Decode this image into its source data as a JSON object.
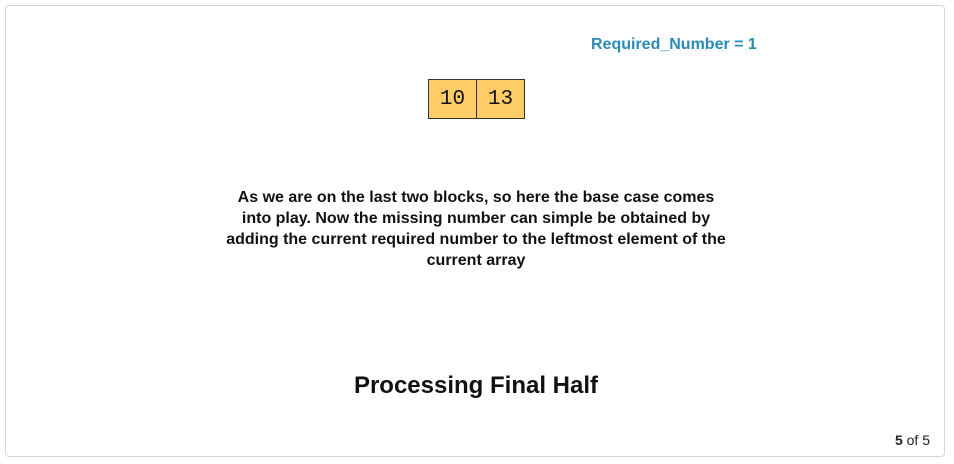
{
  "required_number_label": "Required_Number = 1",
  "array": {
    "cells": [
      "10",
      "13"
    ]
  },
  "description": "As we are on the last two blocks, so here the base case comes into play. Now the missing number can simple be obtained by adding the current required number to the leftmost element of the current array",
  "title": "Processing Final Half",
  "pager": {
    "current": "5",
    "separator": "of",
    "total": "5"
  },
  "colors": {
    "required_label": "#2a8bb5",
    "cell_fill": "#ffcc66",
    "cell_border": "#333333"
  }
}
